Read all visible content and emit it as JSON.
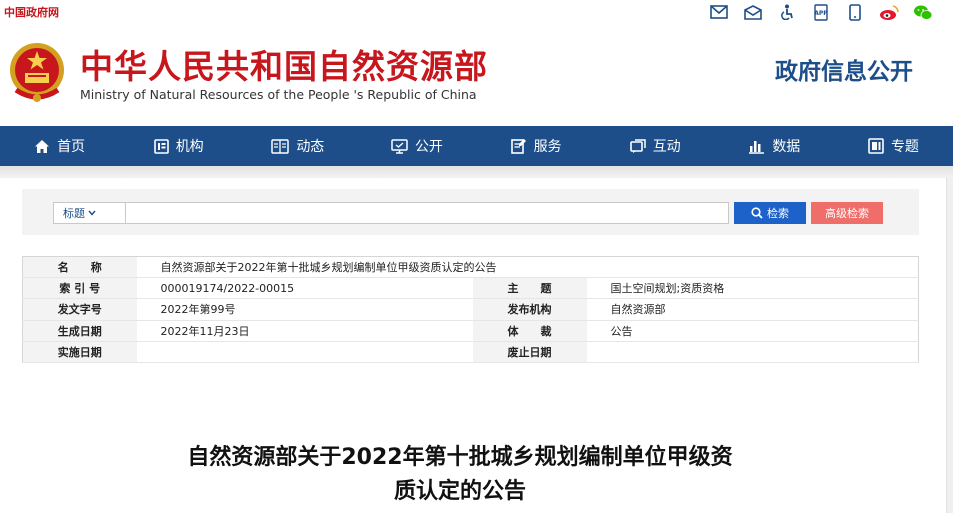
{
  "topbar": {
    "gov_link": "中国政府网",
    "icons": [
      "mail-icon",
      "mail-open-icon",
      "accessibility-icon",
      "app-icon",
      "mobile-icon",
      "weibo-icon",
      "wechat-icon"
    ]
  },
  "header": {
    "title": "中华人民共和国自然资源部",
    "subtitle": "Ministry of Natural Resources of the People 's Republic of China",
    "right_title": "政府信息公开"
  },
  "nav": {
    "items": [
      {
        "label": "首页",
        "icon": "home-icon"
      },
      {
        "label": "机构",
        "icon": "org-icon"
      },
      {
        "label": "动态",
        "icon": "news-icon"
      },
      {
        "label": "公开",
        "icon": "disclosure-icon"
      },
      {
        "label": "服务",
        "icon": "service-icon"
      },
      {
        "label": "互动",
        "icon": "interaction-icon"
      },
      {
        "label": "数据",
        "icon": "data-icon"
      },
      {
        "label": "专题",
        "icon": "topic-icon"
      }
    ]
  },
  "search": {
    "select_value": "标题",
    "input_value": "",
    "search_label": "检索",
    "advanced_label": "高级检索"
  },
  "meta": {
    "name_label": "名　　称",
    "name_value": "自然资源部关于2022年第十批城乡规划编制单位甲级资质认定的公告",
    "index_label": "索 引 号",
    "index_value": "000019174/2022-00015",
    "subject_label": "主　　题",
    "subject_value": "国土空间规划;资质资格",
    "doc_no_label": "发文字号",
    "doc_no_value": "2022年第99号",
    "issuer_label": "发布机构",
    "issuer_value": "自然资源部",
    "date_label": "生成日期",
    "date_value": "2022年11月23日",
    "genre_label": "体　　裁",
    "genre_value": "公告",
    "effective_label": "实施日期",
    "effective_value": "",
    "repeal_label": "废止日期",
    "repeal_value": ""
  },
  "article": {
    "title_line1": "自然资源部关于2022年第十批城乡规划编制单位甲级资",
    "title_line2": "质认定的公告"
  },
  "colors": {
    "brand_red": "#c8161d",
    "nav_blue": "#1d4e89",
    "search_blue": "#1c62c9",
    "advanced_red": "#f06e6a"
  }
}
